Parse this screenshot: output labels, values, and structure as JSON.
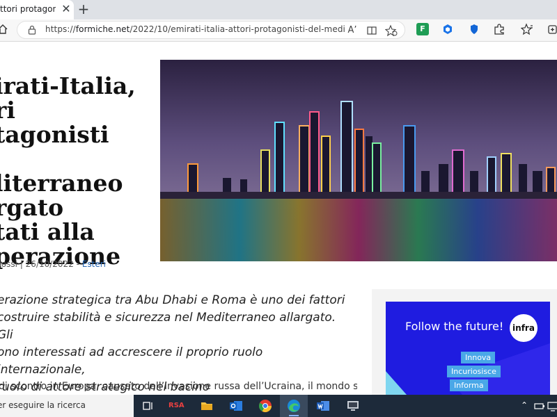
{
  "browser": {
    "tab_title": "ttori protagonisti",
    "url_prefix": "https://",
    "url_domain": "formiche.net",
    "url_path": "/2022/10/emirati-italia-attori-protagonisti-del-mediterraneo...",
    "read_aloud_label": "A’",
    "extension_labels": [
      "F"
    ]
  },
  "article": {
    "headline_lines": [
      "irati-Italia,",
      "ri",
      "tagonisti",
      "",
      "literraneo",
      "rgato",
      "tati alla",
      "perazione"
    ],
    "byline_author": "Rossi",
    "byline_date": "| 26/10/2022 -",
    "byline_category": "Esteri",
    "lead": "erazione strategica tra Abu Dhabi e Roma è uno dei fattori costruire stabilità e sicurezza nel Mediterraneo allargato. Gli ono interessati ad accrescere il proprio ruolo internazionale, ruolo di attore strategico nel bacino",
    "lead_lines": [
      "erazione strategica tra Abu Dhabi e Roma è uno dei fattori",
      "costruire stabilità e sicurezza nel Mediterraneo allargato. Gli",
      "ono interessati ad accrescere il proprio ruolo internazionale,",
      "ruolo di attore strategico nel bacino"
    ],
    "body_start": "di scontro in Europa, causato dall’invasione russa dell’Ucraina, il mondo si mostra"
  },
  "ad": {
    "title": "Follow the future!",
    "logo": "infra",
    "tags": [
      "Innova",
      "Incuriosisce",
      "Informa"
    ],
    "bg_color": "#1f1ce0"
  },
  "taskbar": {
    "search_text": "er eseguire la ricerca",
    "rsa_label": "RSA"
  }
}
